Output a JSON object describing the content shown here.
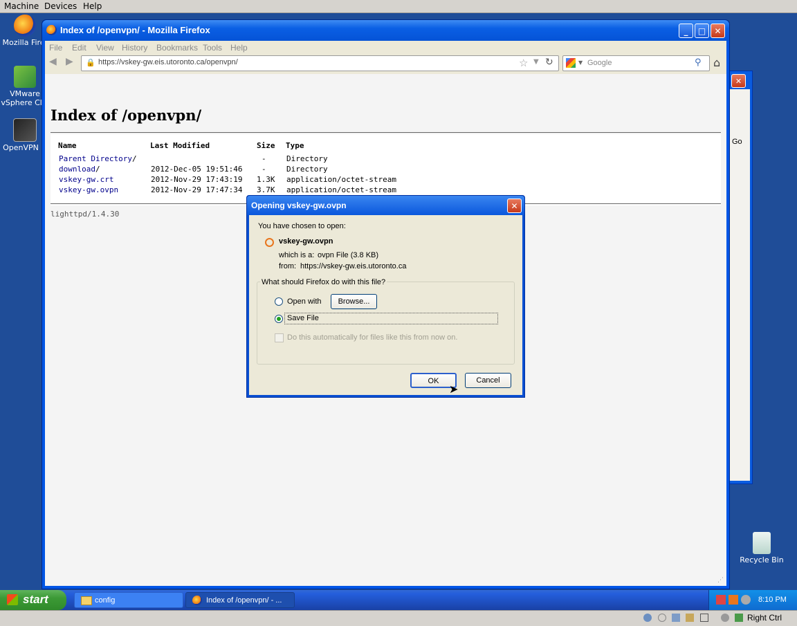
{
  "host_menu": {
    "items": [
      "Machine",
      "Devices",
      "Help"
    ]
  },
  "host_status": {
    "right_ctrl": "Right Ctrl"
  },
  "desktop": {
    "icons": [
      {
        "label": "Mozilla Firef",
        "icon": "firefox-icon"
      },
      {
        "label": "VMware vSphere Clie",
        "icon": "vsphere-icon"
      },
      {
        "label": "OpenVPN G",
        "icon": "openvpn-icon"
      }
    ],
    "recycle_bin": "Recycle Bin"
  },
  "background_window": {
    "go_label": "Go"
  },
  "firefox": {
    "title": "Index of /openvpn/ - Mozilla Firefox",
    "menu": [
      "File",
      "Edit",
      "View",
      "History",
      "Bookmarks",
      "Tools",
      "Help"
    ],
    "url": "https://vskey-gw.eis.utoronto.ca/openvpn/",
    "search_placeholder": "Google"
  },
  "page": {
    "heading": "Index of /openvpn/",
    "columns": [
      "Name",
      "Last Modified",
      "Size",
      "Type"
    ],
    "rows": [
      {
        "name": "Parent Directory",
        "suffix": "/",
        "modified": "",
        "size": "-",
        "type": "Directory"
      },
      {
        "name": "download",
        "suffix": "/",
        "modified": "2012-Dec-05 19:51:46",
        "size": "-",
        "type": "Directory"
      },
      {
        "name": "vskey-gw.crt",
        "suffix": "",
        "modified": "2012-Nov-29 17:43:19",
        "size": "1.3K",
        "type": "application/octet-stream"
      },
      {
        "name": "vskey-gw.ovpn",
        "suffix": "",
        "modified": "2012-Nov-29 17:47:34",
        "size": "3.7K",
        "type": "application/octet-stream"
      }
    ],
    "footer": "lighttpd/1.4.30"
  },
  "dialog": {
    "title": "Opening vskey-gw.ovpn",
    "intro": "You have chosen to open:",
    "filename": "vskey-gw.ovpn",
    "which_is_label": "which is a:",
    "which_is_value": "ovpn File (3.8 KB)",
    "from_label": "from:",
    "from_value": "https://vskey-gw.eis.utoronto.ca",
    "question": "What should Firefox do with this file?",
    "open_with_label": "Open with",
    "browse_label": "Browse...",
    "save_file_label": "Save File",
    "auto_label": "Do this automatically for files like this from now on.",
    "ok_label": "OK",
    "cancel_label": "Cancel",
    "selected_option": "Save File"
  },
  "taskbar": {
    "start_label": "start",
    "tasks": [
      {
        "label": "config",
        "icon": "folder-icon"
      },
      {
        "label": "Index of /openvpn/ - ...",
        "icon": "firefox-icon"
      }
    ],
    "clock": "8:10 PM"
  }
}
